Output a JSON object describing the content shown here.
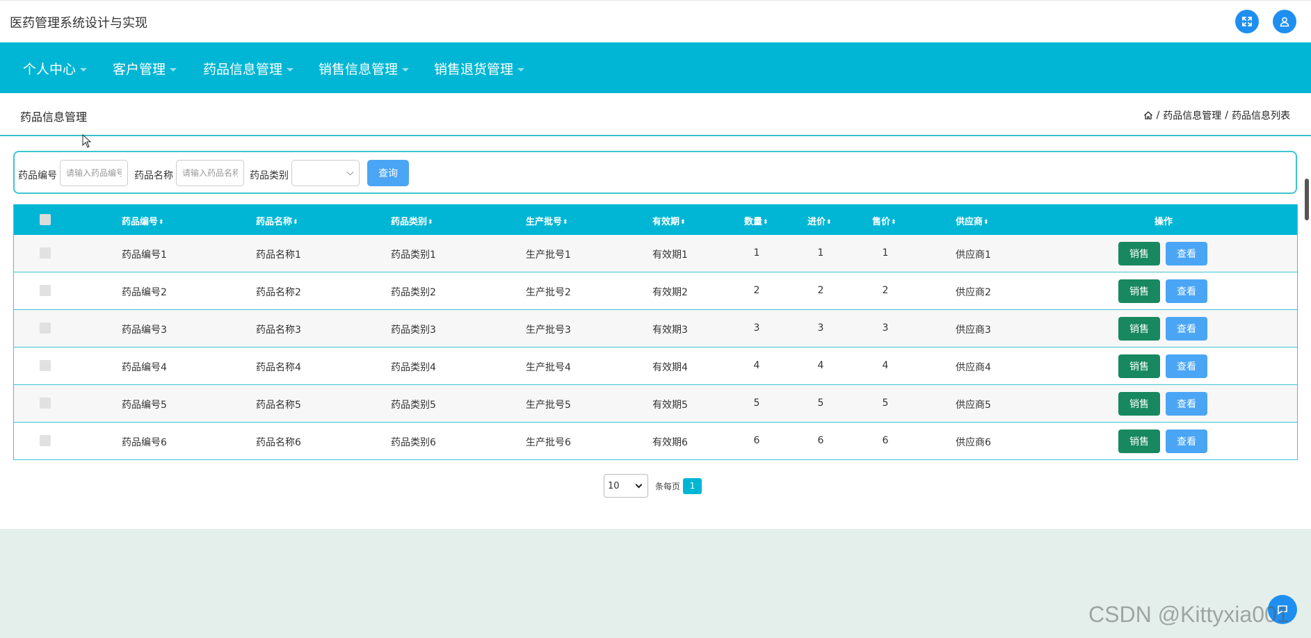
{
  "app_title": "医药管理系统设计与实现",
  "nav": [
    {
      "label": "个人中心"
    },
    {
      "label": "客户管理"
    },
    {
      "label": "药品信息管理"
    },
    {
      "label": "销售信息管理"
    },
    {
      "label": "销售退货管理"
    }
  ],
  "page_title": "药品信息管理",
  "breadcrumb": {
    "separator": "/",
    "level1": "药品信息管理",
    "level2": "药品信息列表"
  },
  "search": {
    "code_label": "药品编号",
    "code_placeholder": "请输入药品编号",
    "name_label": "药品名称",
    "name_placeholder": "请输入药品名称",
    "category_label": "药品类别",
    "category_value": "",
    "query_label": "查询"
  },
  "table": {
    "columns": [
      "药品编号",
      "药品名称",
      "药品类别",
      "生产批号",
      "有效期",
      "数量",
      "进价",
      "售价",
      "供应商",
      "操作"
    ],
    "sort_icon": "⬍",
    "rows": [
      {
        "code": "药品编号1",
        "name": "药品名称1",
        "category": "药品类别1",
        "batch": "生产批号1",
        "expiry": "有效期1",
        "qty": "1",
        "cost": "1",
        "price": "1",
        "supplier": "供应商1"
      },
      {
        "code": "药品编号2",
        "name": "药品名称2",
        "category": "药品类别2",
        "batch": "生产批号2",
        "expiry": "有效期2",
        "qty": "2",
        "cost": "2",
        "price": "2",
        "supplier": "供应商2"
      },
      {
        "code": "药品编号3",
        "name": "药品名称3",
        "category": "药品类别3",
        "batch": "生产批号3",
        "expiry": "有效期3",
        "qty": "3",
        "cost": "3",
        "price": "3",
        "supplier": "供应商3"
      },
      {
        "code": "药品编号4",
        "name": "药品名称4",
        "category": "药品类别4",
        "batch": "生产批号4",
        "expiry": "有效期4",
        "qty": "4",
        "cost": "4",
        "price": "4",
        "supplier": "供应商4"
      },
      {
        "code": "药品编号5",
        "name": "药品名称5",
        "category": "药品类别5",
        "batch": "生产批号5",
        "expiry": "有效期5",
        "qty": "5",
        "cost": "5",
        "price": "5",
        "supplier": "供应商5"
      },
      {
        "code": "药品编号6",
        "name": "药品名称6",
        "category": "药品类别6",
        "batch": "生产批号6",
        "expiry": "有效期6",
        "qty": "6",
        "cost": "6",
        "price": "6",
        "supplier": "供应商6"
      }
    ],
    "sell_label": "销售",
    "view_label": "查看"
  },
  "pagination": {
    "page_size": "10",
    "per_page_label": "条每页",
    "current_page": "1"
  },
  "watermark": "CSDN @Kittyxia001",
  "colors": {
    "nav_bg": "#00b6d4",
    "primary": "#4aa5f5",
    "sell": "#17885f",
    "border": "#3cc6cf"
  },
  "icons": {
    "fullscreen": "expand-icon",
    "user": "user-icon",
    "home": "home-icon"
  }
}
